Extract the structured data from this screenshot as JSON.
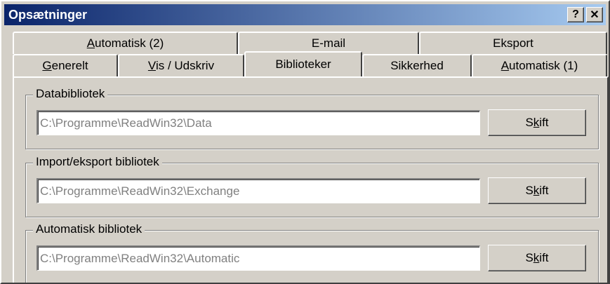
{
  "window": {
    "title": "Opsætninger",
    "help_label": "?",
    "close_label": "✕"
  },
  "tabs_back_row": [
    {
      "pre": "",
      "acc": "A",
      "post": "utomatisk (2)"
    },
    {
      "pre": "",
      "acc": "",
      "post": "E-mail"
    },
    {
      "pre": "",
      "acc": "",
      "post": "Eksport"
    }
  ],
  "tabs_front_row": [
    {
      "pre": "",
      "acc": "G",
      "post": "enerelt"
    },
    {
      "pre": "",
      "acc": "V",
      "post": "is / Udskriv"
    },
    {
      "pre": "",
      "acc": "",
      "post": "Biblioteker"
    },
    {
      "pre": "",
      "acc": "",
      "post": "Sikkerhed"
    },
    {
      "pre": "",
      "acc": "A",
      "post": "utomatisk (1)"
    }
  ],
  "active_tab": "Biblioteker",
  "groups": [
    {
      "legend": "Databibliotek",
      "path": "C:\\Programme\\ReadWin32\\Data",
      "btn_pre": "S",
      "btn_acc": "k",
      "btn_post": "ift"
    },
    {
      "legend": "Import/eksport bibliotek",
      "path": "C:\\Programme\\ReadWin32\\Exchange",
      "btn_pre": "S",
      "btn_acc": "k",
      "btn_post": "ift"
    },
    {
      "legend": "Automatisk bibliotek",
      "path": "C:\\Programme\\ReadWin32\\Automatic",
      "btn_pre": "S",
      "btn_acc": "k",
      "btn_post": "ift"
    }
  ],
  "colors": {
    "title_start": "#0a246a",
    "title_end": "#a6caf0",
    "face": "#d4d0c8",
    "disabled_text": "#808080"
  }
}
